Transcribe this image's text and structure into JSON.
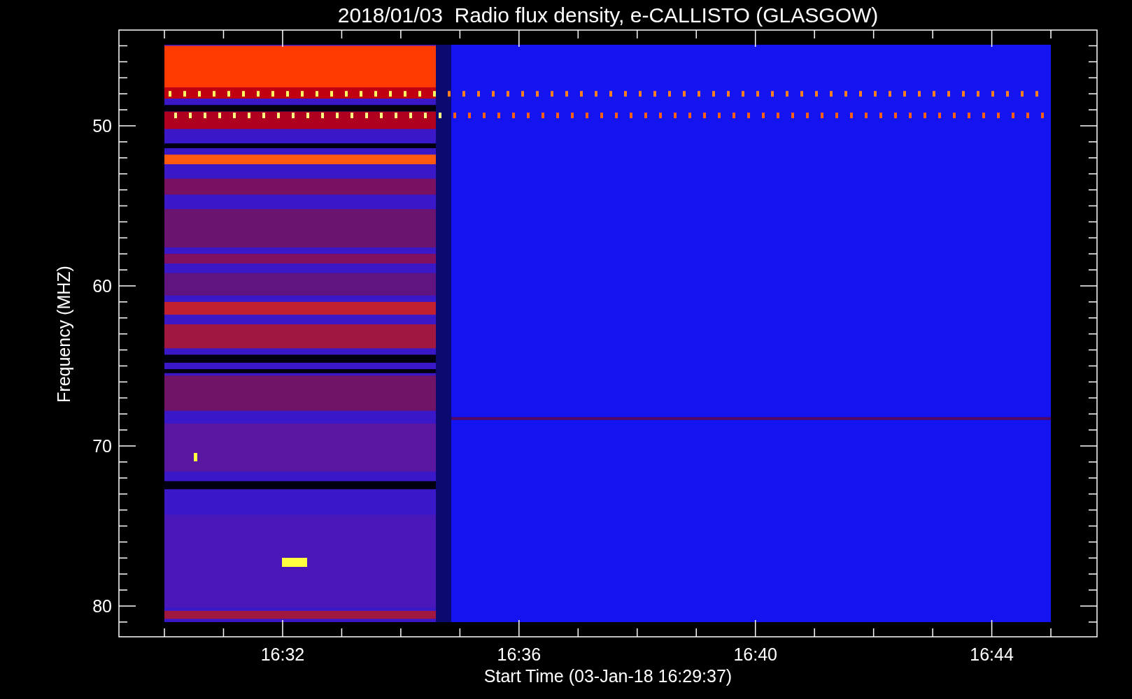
{
  "title": "2018/01/03  Radio flux density, e-CALLISTO (GLASGOW)",
  "ylabel": "Frequency (MHZ)",
  "xlabel": "Start Time (03-Jan-18 16:29:37)",
  "yticks": [
    "50",
    "60",
    "70",
    "80"
  ],
  "xticks": [
    "16:32",
    "16:36",
    "16:40",
    "16:44"
  ]
}
